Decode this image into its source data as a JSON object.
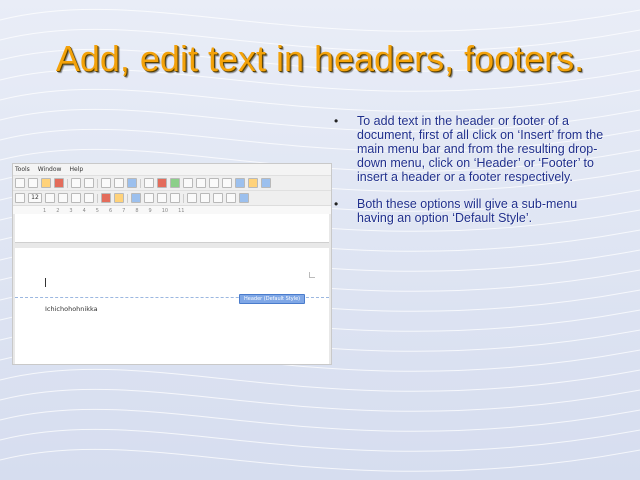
{
  "slide": {
    "title": "Add, edit text in headers, footers.",
    "bullets": [
      "To add text in the header or footer of a document, first of all click on ‘Insert’ from the main menu bar and from the resulting drop-down menu, click on ‘Header’ or ‘Footer’ to insert a header or a footer respectively.",
      "Both these options will give a sub-menu having an option ‘Default Style’."
    ],
    "bullet_char": "•"
  },
  "screenshot": {
    "menu_items": [
      "Tools",
      "Window",
      "Help"
    ],
    "font_size_value": "12",
    "header_tag": "Header (Default Style)",
    "doc_text": "Ichichohohnikka"
  },
  "colors": {
    "title": "#f3a20a",
    "bullet_text": "#1f2f8c",
    "header_tag": "#7fa7e6"
  }
}
